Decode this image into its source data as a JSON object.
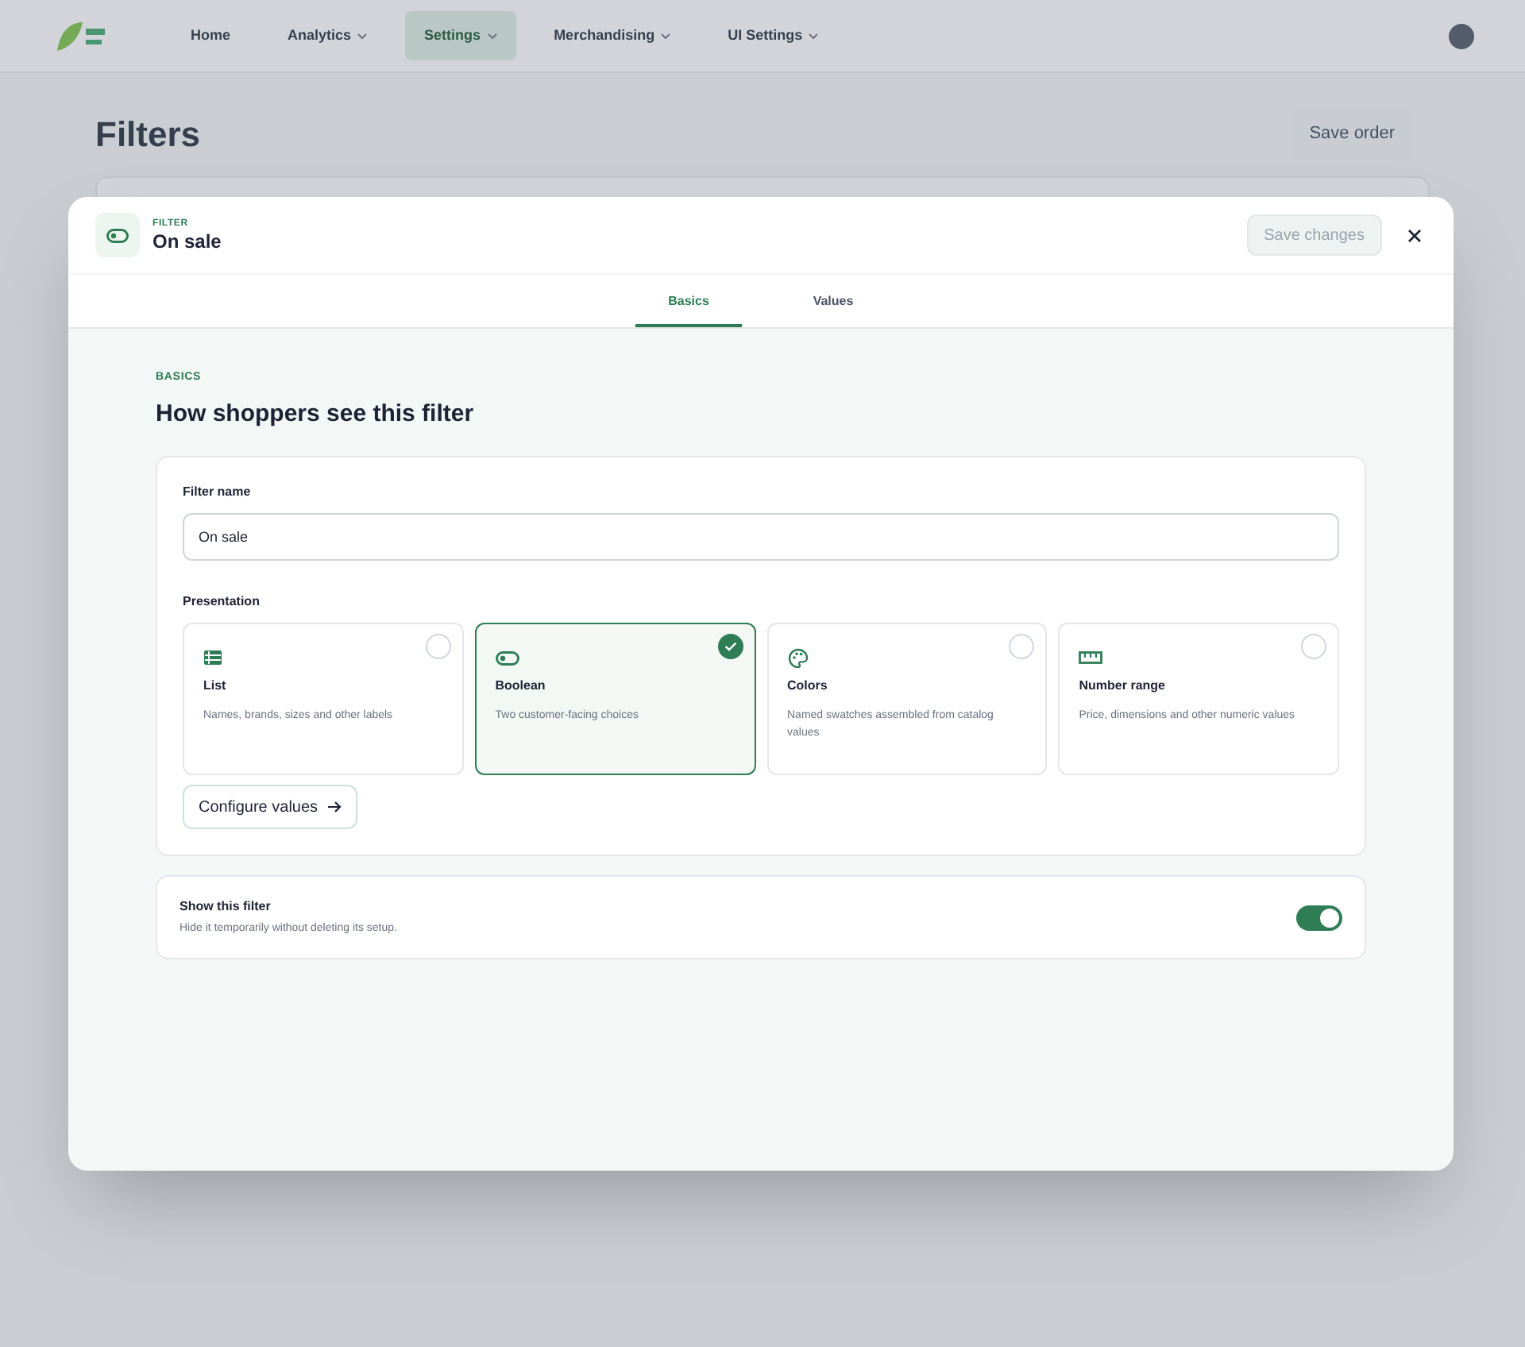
{
  "background": {
    "nav": [
      {
        "label": "Home",
        "dropdown": false,
        "selected": false
      },
      {
        "label": "Analytics",
        "dropdown": true,
        "selected": false
      },
      {
        "label": "Settings",
        "dropdown": true,
        "selected": true
      },
      {
        "label": "Merchandising",
        "dropdown": true,
        "selected": false
      },
      {
        "label": "UI Settings",
        "dropdown": true,
        "selected": false
      }
    ],
    "page_title": "Filters",
    "action_button": "Save order"
  },
  "dialog": {
    "eyebrow": "FILTER",
    "title": "On sale",
    "save_button": {
      "label": "Save changes",
      "disabled": true
    },
    "tabs": [
      {
        "label": "Basics",
        "selected": true
      },
      {
        "label": "Values",
        "selected": false
      }
    ],
    "section_eyebrow": "BASICS",
    "section_title": "How shoppers see this filter",
    "filter_name": {
      "label": "Filter name",
      "value": "On sale"
    },
    "presentation": {
      "label": "Presentation",
      "options": [
        {
          "kind": "list",
          "title": "List",
          "description": "Names, brands, sizes and other labels",
          "selected": false
        },
        {
          "kind": "toggle",
          "title": "Boolean",
          "description": "Two customer-facing choices",
          "selected": true
        },
        {
          "kind": "palette",
          "title": "Colors",
          "description": "Named swatches assembled from catalog values",
          "selected": false
        },
        {
          "kind": "ruler",
          "title": "Number range",
          "description": "Price, dimensions and other numeric values",
          "selected": false
        }
      ]
    },
    "configure_button": "Configure values",
    "visibility": {
      "title": "Show this filter",
      "description": "Hide it temporarily without deleting its setup.",
      "on": true
    }
  }
}
